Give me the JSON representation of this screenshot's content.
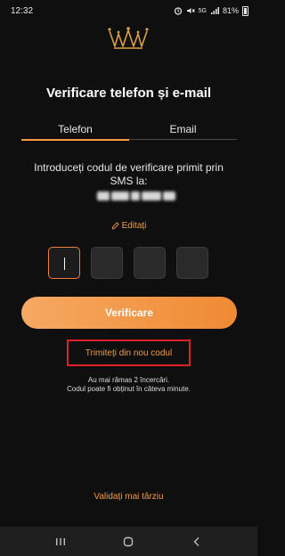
{
  "status_bar": {
    "time": "12:32",
    "signal_label": "5G",
    "battery": "81%",
    "icons": [
      "alarm-icon",
      "mute-icon",
      "signal-icon",
      "battery-icon"
    ]
  },
  "logo": {
    "icon": "crown-logo-icon",
    "color": "#d6a04a"
  },
  "page": {
    "title": "Verificare telefon și e-mail",
    "tabs": [
      {
        "label": "Telefon",
        "active": true
      },
      {
        "label": "Email",
        "active": false
      }
    ],
    "instruction": "Introduceți codul de verificare primit prin SMS la:",
    "edit_label": "Editați",
    "code_digits": [
      "",
      "",
      "",
      ""
    ],
    "verify_label": "Verificare",
    "resend_label": "Trimiteți din nou codul",
    "attempts_line1": "Au mai rămas 2 încercări.",
    "attempts_line2": "Codul poate fi obținut în câteva minute.",
    "later_label": "Validați mai târziu"
  },
  "colors": {
    "background": "#0f0f0f",
    "accent": "#f29a46",
    "highlight_border": "#e0202a"
  },
  "navbar": {
    "icons": [
      "recent-apps-icon",
      "home-icon",
      "back-icon"
    ]
  }
}
